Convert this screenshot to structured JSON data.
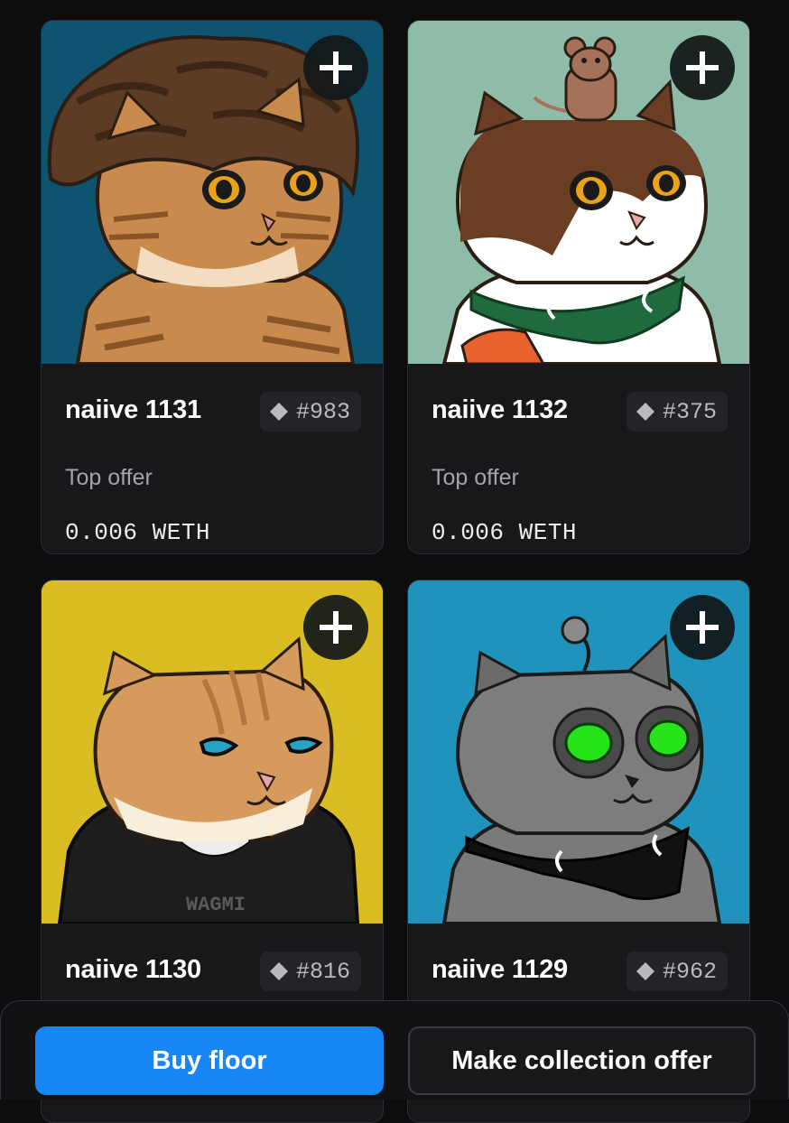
{
  "cards": [
    {
      "name": "naiive 1131",
      "rank": "#983",
      "offer_label": "Top offer",
      "offer_value": "0.006 WETH",
      "bg": "#0e5470"
    },
    {
      "name": "naiive 1132",
      "rank": "#375",
      "offer_label": "Top offer",
      "offer_value": "0.006 WETH",
      "bg": "#8fbca8"
    },
    {
      "name": "naiive 1130",
      "rank": "#816",
      "bg": "#d9bd22"
    },
    {
      "name": "naiive 1129",
      "rank": "#962",
      "bg": "#1f93bb"
    }
  ],
  "actions": {
    "buy_floor": "Buy floor",
    "make_offer": "Make collection offer"
  },
  "icons": {
    "add": "plus-icon",
    "rarity": "diamond-icon"
  },
  "colors": {
    "primary": "#1886f7",
    "surface": "#18181b",
    "background": "#0d0d0f"
  },
  "art_text": {
    "hoodie": "WAGMI"
  }
}
